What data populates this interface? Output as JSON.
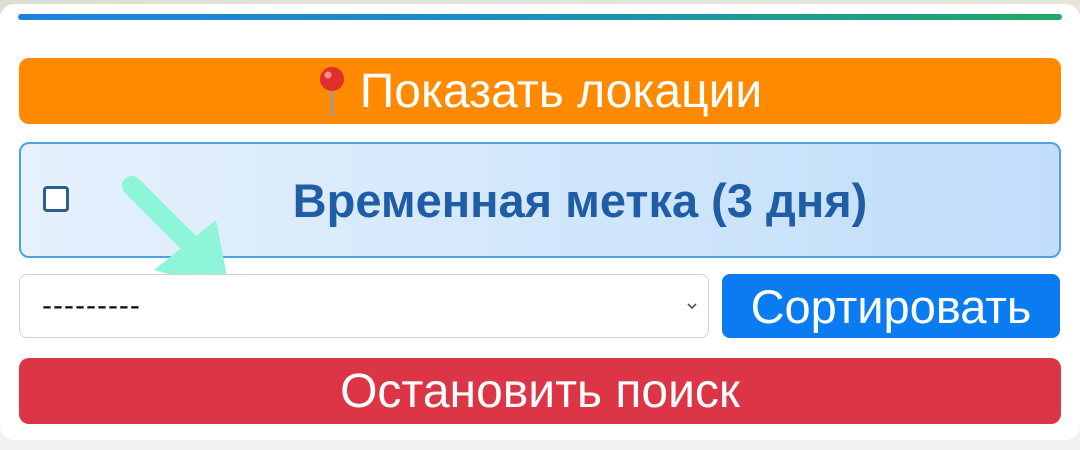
{
  "progress": {
    "value": 1.0,
    "colors": [
      "#1f7fe0",
      "#20a866"
    ]
  },
  "buttons": {
    "show_locations": {
      "label": "Показать локации",
      "icon": "map-pin-icon",
      "color": "#ff8a00"
    },
    "sort": {
      "label": "Сортировать",
      "color": "#0b7bf2"
    },
    "stop_search": {
      "label": "Остановить поиск",
      "color": "#dc3545"
    }
  },
  "temp_mark": {
    "label": "Временная метка (3 дня)",
    "checked": false
  },
  "sort_select": {
    "selected": "---------",
    "icon": "chevron-down-icon"
  },
  "annotation": {
    "icon": "arrow-pointer-icon",
    "color": "#8ef5d8"
  }
}
